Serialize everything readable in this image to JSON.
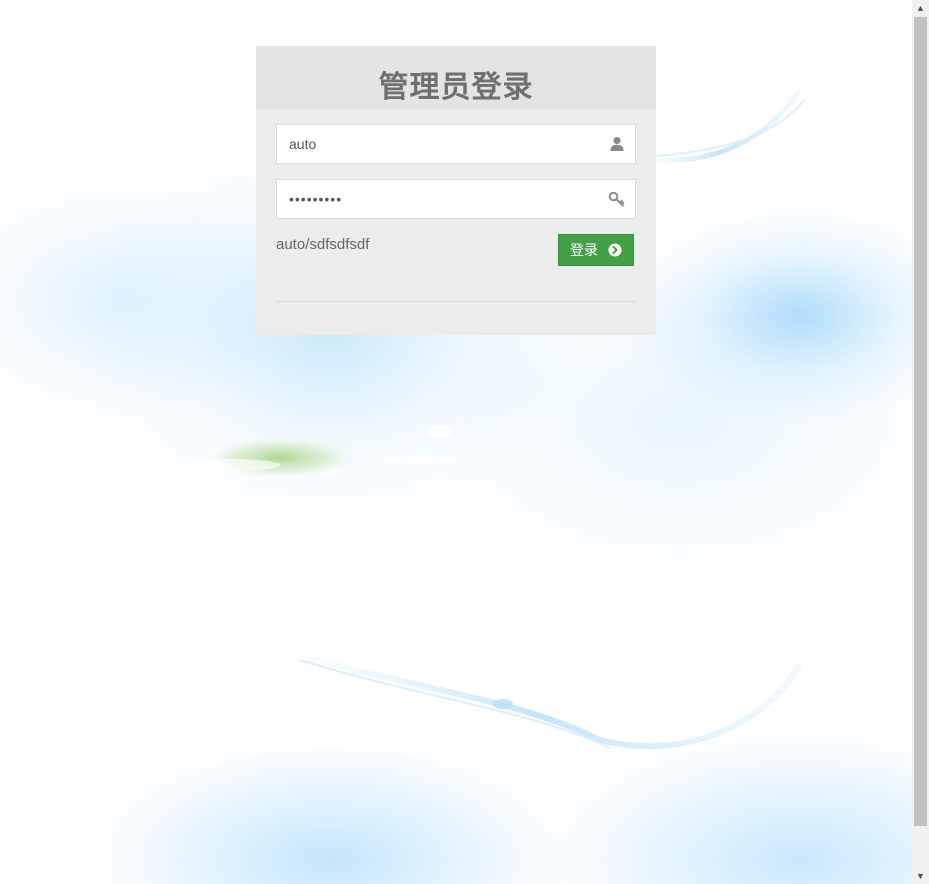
{
  "login": {
    "title": "管理员登录",
    "username": {
      "value": "auto",
      "icon": "user-icon"
    },
    "password": {
      "value": "sdfsdfsdf",
      "icon": "key-icon"
    },
    "hint": "auto/sdfsdfsdf",
    "submit": {
      "label": "登录",
      "icon": "chevron-right-circle-icon"
    }
  },
  "colors": {
    "panel_bg": "#ececec",
    "header_bg": "#e4e4e4",
    "title_text": "#6f6f6f",
    "button_bg": "#43a047",
    "sky_blue": "#a6d9fb"
  }
}
